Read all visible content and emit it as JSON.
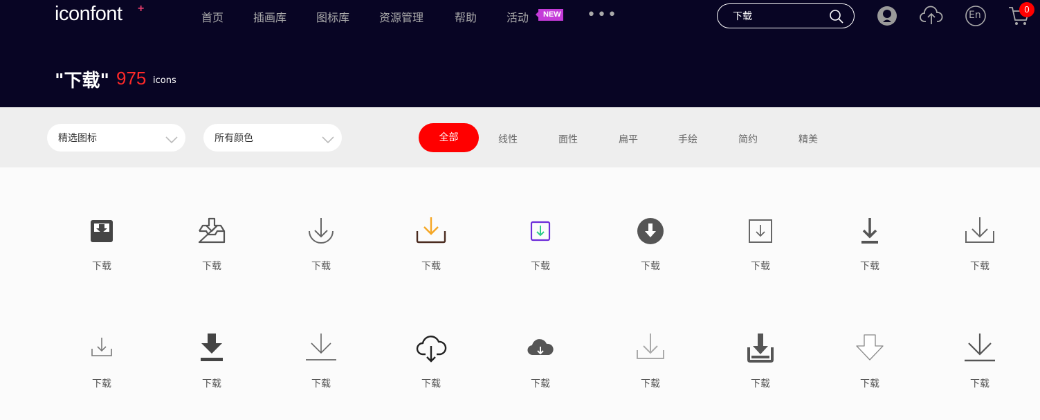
{
  "header": {
    "logo": "iconfont",
    "logo_plus": "+",
    "nav": [
      "首页",
      "插画库",
      "图标库",
      "资源管理",
      "帮助",
      "活动"
    ],
    "new_badge": "NEW",
    "more": "•••",
    "search": {
      "value": "下载",
      "placeholder": ""
    },
    "cart_count": "0",
    "lang": "En"
  },
  "result": {
    "query": "\"下载\"",
    "count": "975",
    "unit": "icons"
  },
  "filters": {
    "select1": "精选图标",
    "select2": "所有颜色",
    "tabs": [
      "全部",
      "线性",
      "面性",
      "扁平",
      "手绘",
      "简约",
      "精美"
    ],
    "active_tab": 0
  },
  "icons": [
    {
      "name": "下载",
      "icon": "tray-download-square"
    },
    {
      "name": "下载",
      "icon": "inbox-download-outline"
    },
    {
      "name": "下载",
      "icon": "arrow-bowl-line"
    },
    {
      "name": "下载",
      "icon": "arrow-bowl-yellow"
    },
    {
      "name": "下载",
      "icon": "square-arrow-purple-green"
    },
    {
      "name": "下载",
      "icon": "circle-arrow-down-filled"
    },
    {
      "name": "下载",
      "icon": "square-arrow-outline"
    },
    {
      "name": "下载",
      "icon": "arrow-to-line"
    },
    {
      "name": "下载",
      "icon": "tray-arrow-thin"
    },
    {
      "name": "下载",
      "icon": "tray-arrow-small"
    },
    {
      "name": "下载",
      "icon": "arrow-bar-bold"
    },
    {
      "name": "下载",
      "icon": "arrow-line-thin"
    },
    {
      "name": "下载",
      "icon": "cloud-download-outline"
    },
    {
      "name": "下载",
      "icon": "cloud-download-filled"
    },
    {
      "name": "下载",
      "icon": "tray-arrow-light"
    },
    {
      "name": "下载",
      "icon": "tray-arrow-filled"
    },
    {
      "name": "下载",
      "icon": "arrow-down-outline-shape"
    },
    {
      "name": "下载",
      "icon": "arrow-line-large"
    }
  ],
  "colors": {
    "header_bg": "#080524",
    "accent": "#ff0000",
    "count": "#ff2929",
    "new_badge": "#c43bd8"
  }
}
